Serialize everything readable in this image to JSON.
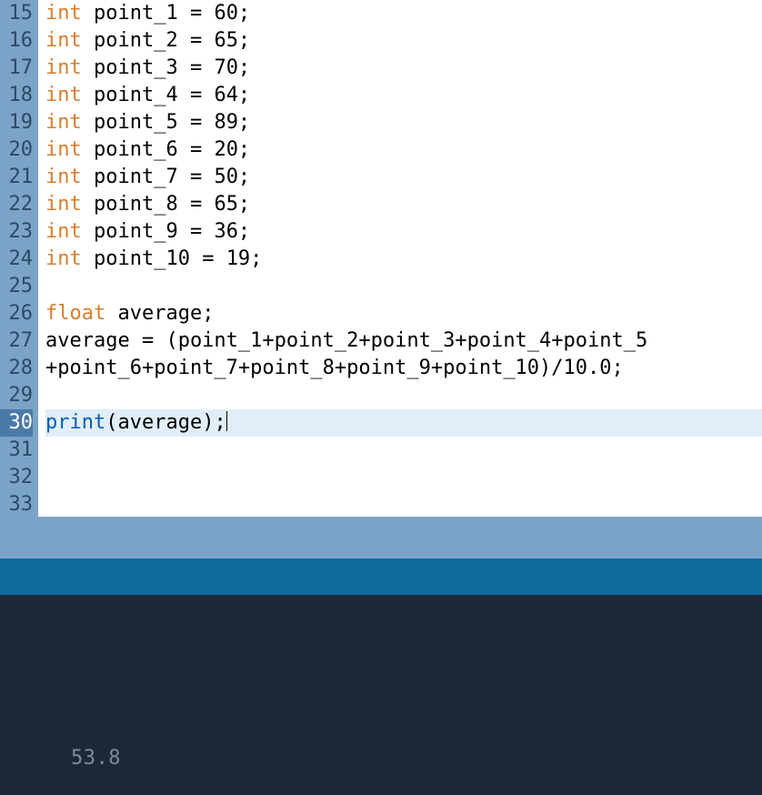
{
  "editor": {
    "first_line_number": 15,
    "active_line_index": 15,
    "lines": [
      {
        "tokens": [
          {
            "t": "int",
            "c": "kw-type"
          },
          {
            "t": " point_1 = 60;",
            "c": ""
          }
        ]
      },
      {
        "tokens": [
          {
            "t": "int",
            "c": "kw-type"
          },
          {
            "t": " point_2 = 65;",
            "c": ""
          }
        ]
      },
      {
        "tokens": [
          {
            "t": "int",
            "c": "kw-type"
          },
          {
            "t": " point_3 = 70;",
            "c": ""
          }
        ]
      },
      {
        "tokens": [
          {
            "t": "int",
            "c": "kw-type"
          },
          {
            "t": " point_4 = 64;",
            "c": ""
          }
        ]
      },
      {
        "tokens": [
          {
            "t": "int",
            "c": "kw-type"
          },
          {
            "t": " point_5 = 89;",
            "c": ""
          }
        ]
      },
      {
        "tokens": [
          {
            "t": "int",
            "c": "kw-type"
          },
          {
            "t": " point_6 = 20;",
            "c": ""
          }
        ]
      },
      {
        "tokens": [
          {
            "t": "int",
            "c": "kw-type"
          },
          {
            "t": " point_7 = 50;",
            "c": ""
          }
        ]
      },
      {
        "tokens": [
          {
            "t": "int",
            "c": "kw-type"
          },
          {
            "t": " point_8 = 65;",
            "c": ""
          }
        ]
      },
      {
        "tokens": [
          {
            "t": "int",
            "c": "kw-type"
          },
          {
            "t": " point_9 = 36;",
            "c": ""
          }
        ]
      },
      {
        "tokens": [
          {
            "t": "int",
            "c": "kw-type"
          },
          {
            "t": " point_10 = 19;",
            "c": ""
          }
        ]
      },
      {
        "tokens": []
      },
      {
        "tokens": [
          {
            "t": "float",
            "c": "kw-type"
          },
          {
            "t": " average;",
            "c": ""
          }
        ]
      },
      {
        "tokens": [
          {
            "t": "average = (point_1+point_2+point_3+point_4+point_5",
            "c": ""
          }
        ]
      },
      {
        "tokens": [
          {
            "t": "+point_6+point_7+point_8+point_9+point_10)/10.0;",
            "c": ""
          }
        ]
      },
      {
        "tokens": []
      },
      {
        "tokens": [
          {
            "t": "print",
            "c": "kw-func"
          },
          {
            "t": "(average);",
            "c": ""
          }
        ],
        "cursor_after": true
      },
      {
        "tokens": []
      },
      {
        "tokens": []
      },
      {
        "tokens": []
      }
    ]
  },
  "console": {
    "output": "53.8"
  }
}
